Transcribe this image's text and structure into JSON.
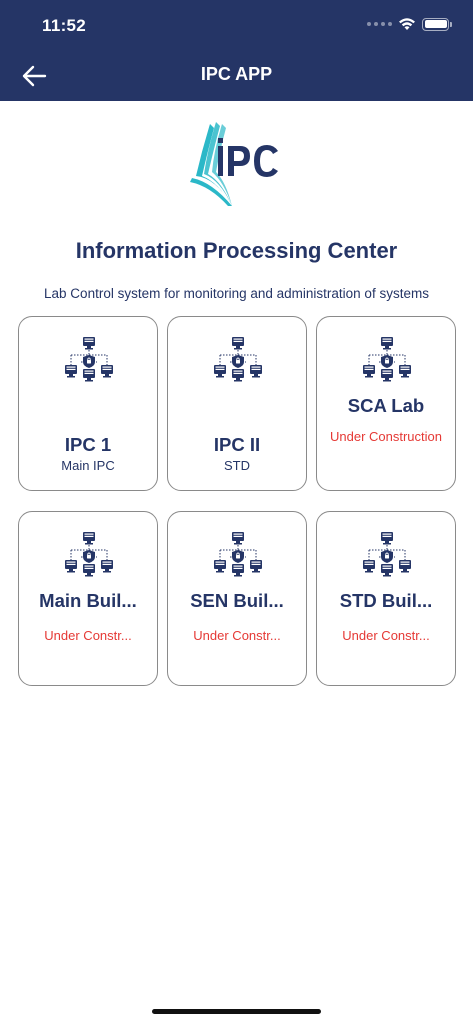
{
  "status_bar": {
    "time": "11:52"
  },
  "header": {
    "title": "IPC APP",
    "back_icon": "arrow-left-icon"
  },
  "logo": {
    "text": "IPC",
    "brand_color": "#2bb8c8",
    "text_color": "#253566"
  },
  "main": {
    "title": "Information Processing Center",
    "subtitle": "Lab Control system for monitoring and administration of systems"
  },
  "cards": [
    {
      "title": "IPC 1",
      "subtitle": "Main IPC",
      "icon": "network-lock-icon"
    },
    {
      "title": "IPC II",
      "subtitle": "STD",
      "icon": "network-lock-icon"
    },
    {
      "title": "SCA Lab",
      "subtitle": "Under Construction",
      "icon": "network-lock-icon"
    },
    {
      "title": "Main Buil...",
      "subtitle": "Under Constr...",
      "icon": "network-lock-icon"
    },
    {
      "title": "SEN Buil...",
      "subtitle": "Under Constr...",
      "icon": "network-lock-icon"
    },
    {
      "title": "STD Buil...",
      "subtitle": "Under Constr...",
      "icon": "network-lock-icon"
    }
  ],
  "colors": {
    "header_bg": "#253566",
    "primary_text": "#253566",
    "warning_text": "#e53935",
    "card_border": "#8a8a8a"
  }
}
